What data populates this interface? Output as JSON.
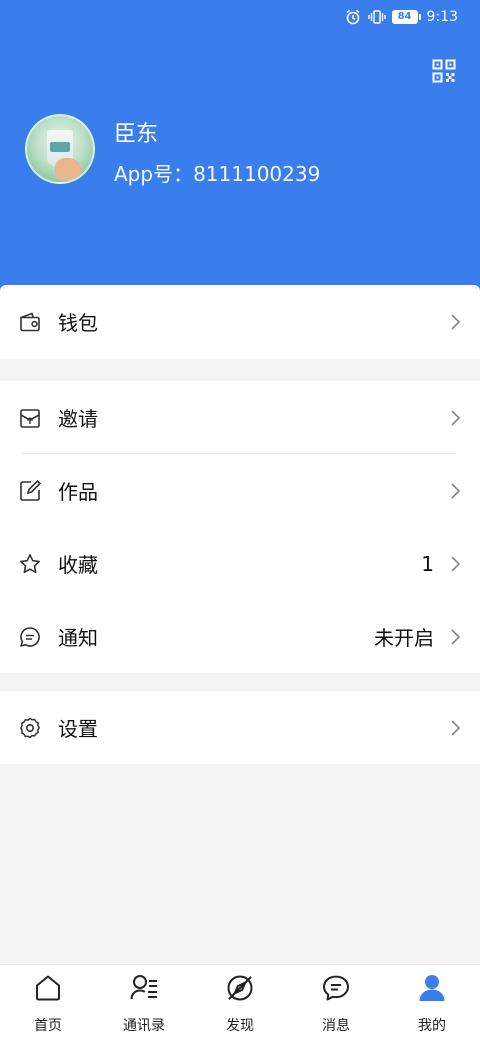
{
  "status_bar": {
    "battery": "84",
    "time": "9:13",
    "icons": [
      "alarm-icon",
      "vibrate-icon",
      "battery-icon"
    ]
  },
  "profile": {
    "name": "臣东",
    "app_id": "App号：8111100239",
    "qr_icon": "qr-code-icon"
  },
  "menu": {
    "wallet": {
      "label": "钱包",
      "icon": "wallet-icon"
    },
    "invite": {
      "label": "邀请",
      "icon": "invite-icon"
    },
    "works": {
      "label": "作品",
      "icon": "edit-icon"
    },
    "favorites": {
      "label": "收藏",
      "value": "1",
      "icon": "star-icon"
    },
    "notifications": {
      "label": "通知",
      "value": "未开启",
      "icon": "message-icon"
    },
    "settings": {
      "label": "设置",
      "icon": "gear-icon"
    }
  },
  "tabbar": {
    "items": [
      {
        "label": "首页",
        "icon": "home-icon",
        "active": false
      },
      {
        "label": "通讯录",
        "icon": "contacts-icon",
        "active": false
      },
      {
        "label": "发现",
        "icon": "discover-icon",
        "active": false
      },
      {
        "label": "消息",
        "icon": "chat-icon",
        "active": false
      },
      {
        "label": "我的",
        "icon": "user-icon",
        "active": true
      }
    ]
  },
  "colors": {
    "primary": "#3a7ded",
    "background": "#f4f4f4"
  }
}
